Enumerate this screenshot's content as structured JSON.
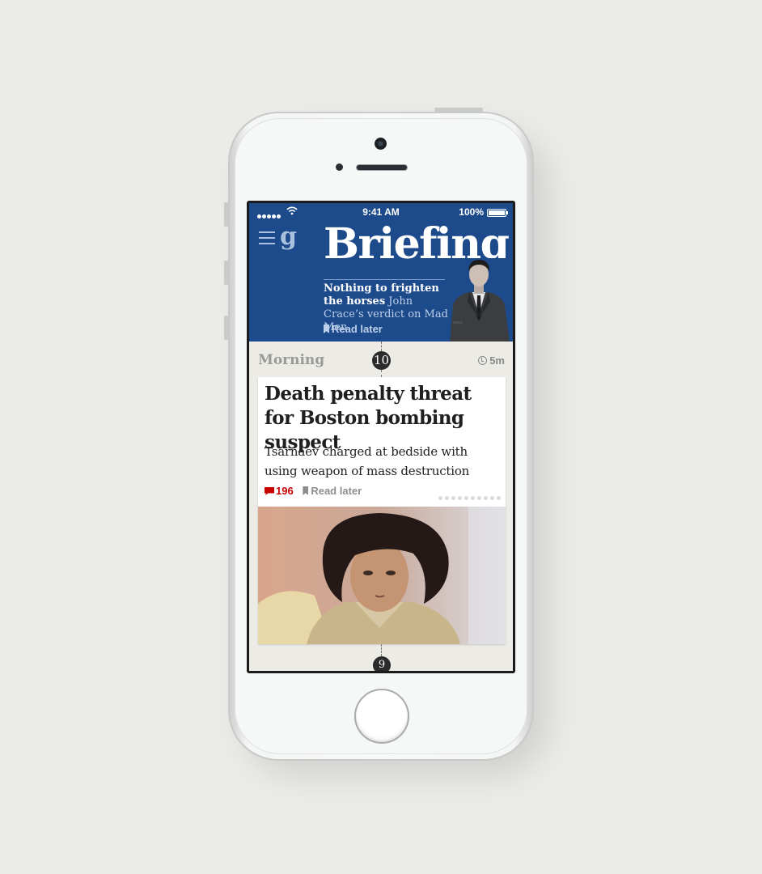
{
  "status_bar": {
    "time": "9:41 AM",
    "battery": "100%"
  },
  "header": {
    "logo": "g",
    "title": "Briefing",
    "teaser_bold": "Nothing to frighten the horses",
    "teaser_light": "John Crace’s verdict on Mad Men",
    "read_later": "Read later",
    "colors": {
      "background": "#1d4a8a",
      "muted": "#bcd0ec"
    }
  },
  "section": {
    "label": "Morning",
    "issue_number": "10",
    "read_time": "5m"
  },
  "article": {
    "headline": "Death penalty threat for Boston bombing suspect",
    "standfirst": "Tsarnaev charged at bedside with using weapon of mass destruction",
    "comment_count": "196",
    "read_later": "Read later",
    "accent_color": "#c70000",
    "page_indicator_count": 10
  },
  "next": {
    "issue_number": "9"
  },
  "icons": [
    "signal-icon",
    "wifi-icon",
    "battery-icon",
    "menu-icon",
    "guardian-logo",
    "bookmark-icon",
    "clock-icon",
    "comment-icon"
  ]
}
